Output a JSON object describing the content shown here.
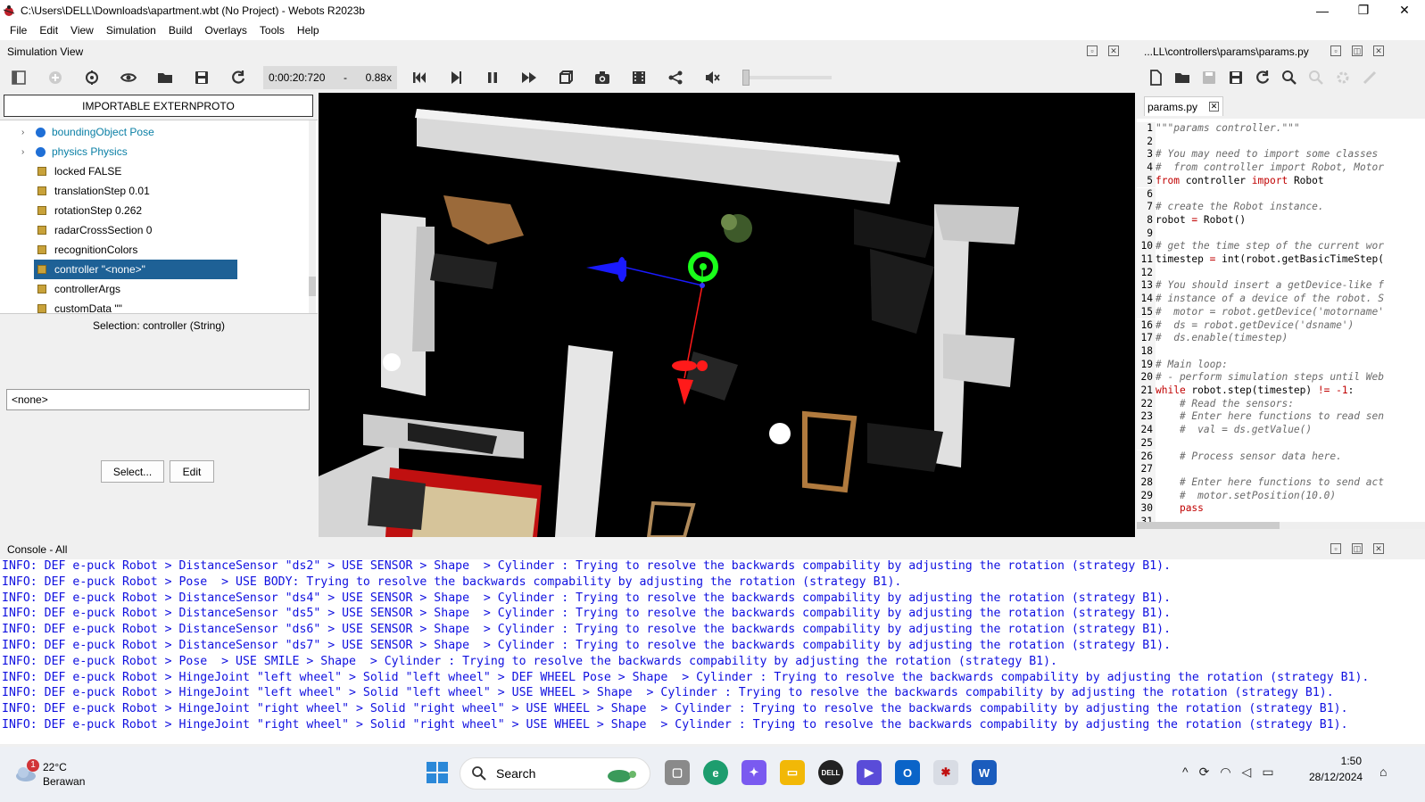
{
  "window": {
    "title": "C:\\Users\\DELL\\Downloads\\apartment.wbt (No Project) - Webots R2023b",
    "minimize": "—",
    "maximize": "❐",
    "close": "✕"
  },
  "menu": [
    "File",
    "Edit",
    "View",
    "Simulation",
    "Build",
    "Overlays",
    "Tools",
    "Help"
  ],
  "sim_view": {
    "header": "Simulation View",
    "time": "0:00:20:720",
    "dash": "-",
    "speed": "0.88x"
  },
  "scene_tree": {
    "proto_button": "IMPORTABLE EXTERNPROTO",
    "nodes": [
      {
        "label": "boundingObject Pose",
        "kind": "node"
      },
      {
        "label": "physics Physics",
        "kind": "node"
      },
      {
        "label": "locked FALSE",
        "kind": "field"
      },
      {
        "label": "translationStep 0.01",
        "kind": "field"
      },
      {
        "label": "rotationStep 0.262",
        "kind": "field"
      },
      {
        "label": "radarCrossSection 0",
        "kind": "field"
      },
      {
        "label": "recognitionColors",
        "kind": "field"
      },
      {
        "label": "controller \"<none>\"",
        "kind": "field",
        "selected": true
      },
      {
        "label": "controllerArgs",
        "kind": "field"
      },
      {
        "label": "customData \"\"",
        "kind": "field"
      }
    ],
    "selection": "Selection: controller (String)",
    "value": "<none>",
    "select_button": "Select...",
    "edit_button": "Edit"
  },
  "editor": {
    "header": "...LL\\controllers\\params\\params.py",
    "tab": "params.py",
    "lines": [
      {
        "n": "1",
        "segs": [
          [
            "cmt",
            "\"\"\"params controller.\"\"\""
          ]
        ]
      },
      {
        "n": "2",
        "segs": []
      },
      {
        "n": "3",
        "segs": [
          [
            "cmt",
            "# You may need to import some classes"
          ]
        ]
      },
      {
        "n": "4",
        "segs": [
          [
            "cmt",
            "#  from controller import Robot, Motor"
          ]
        ]
      },
      {
        "n": "5",
        "segs": [
          [
            "kw",
            "from"
          ],
          [
            "tx",
            " controller "
          ],
          [
            "kw",
            "import"
          ],
          [
            "tx",
            " Robot"
          ]
        ]
      },
      {
        "n": "6",
        "segs": []
      },
      {
        "n": "7",
        "segs": [
          [
            "cmt",
            "# create the Robot instance."
          ]
        ]
      },
      {
        "n": "8",
        "segs": [
          [
            "tx",
            "robot "
          ],
          [
            "op",
            "="
          ],
          [
            "tx",
            " Robot()"
          ]
        ]
      },
      {
        "n": "9",
        "segs": []
      },
      {
        "n": "10",
        "segs": [
          [
            "cmt",
            "# get the time step of the current wor"
          ]
        ]
      },
      {
        "n": "11",
        "segs": [
          [
            "tx",
            "timestep "
          ],
          [
            "op",
            "="
          ],
          [
            "tx",
            " int(robot.getBasicTimeStep("
          ]
        ]
      },
      {
        "n": "12",
        "segs": []
      },
      {
        "n": "13",
        "segs": [
          [
            "cmt",
            "# You should insert a getDevice-like f"
          ]
        ]
      },
      {
        "n": "14",
        "segs": [
          [
            "cmt",
            "# instance of a device of the robot. S"
          ]
        ]
      },
      {
        "n": "15",
        "segs": [
          [
            "cmt",
            "#  motor = robot.getDevice('motorname'"
          ]
        ]
      },
      {
        "n": "16",
        "segs": [
          [
            "cmt",
            "#  ds = robot.getDevice('dsname')"
          ]
        ]
      },
      {
        "n": "17",
        "segs": [
          [
            "cmt",
            "#  ds.enable(timestep)"
          ]
        ]
      },
      {
        "n": "18",
        "segs": []
      },
      {
        "n": "19",
        "segs": [
          [
            "cmt",
            "# Main loop:"
          ]
        ]
      },
      {
        "n": "20",
        "segs": [
          [
            "cmt",
            "# - perform simulation steps until Web"
          ]
        ]
      },
      {
        "n": "21",
        "segs": [
          [
            "kw",
            "while"
          ],
          [
            "tx",
            " robot.step(timestep) "
          ],
          [
            "op",
            "!="
          ],
          [
            "tx",
            " "
          ],
          [
            "op",
            "-1"
          ],
          [
            "tx",
            ":"
          ]
        ]
      },
      {
        "n": "22",
        "segs": [
          [
            "tx",
            "    "
          ],
          [
            "cmt",
            "# Read the sensors:"
          ]
        ]
      },
      {
        "n": "23",
        "segs": [
          [
            "tx",
            "    "
          ],
          [
            "cmt",
            "# Enter here functions to read sen"
          ]
        ]
      },
      {
        "n": "24",
        "segs": [
          [
            "tx",
            "    "
          ],
          [
            "cmt",
            "#  val = ds.getValue()"
          ]
        ]
      },
      {
        "n": "25",
        "segs": []
      },
      {
        "n": "26",
        "segs": [
          [
            "tx",
            "    "
          ],
          [
            "cmt",
            "# Process sensor data here."
          ]
        ]
      },
      {
        "n": "27",
        "segs": []
      },
      {
        "n": "28",
        "segs": [
          [
            "tx",
            "    "
          ],
          [
            "cmt",
            "# Enter here functions to send act"
          ]
        ]
      },
      {
        "n": "29",
        "segs": [
          [
            "tx",
            "    "
          ],
          [
            "cmt",
            "#  motor.setPosition(10.0)"
          ]
        ]
      },
      {
        "n": "30",
        "segs": [
          [
            "tx",
            "    "
          ],
          [
            "kw",
            "pass"
          ]
        ]
      },
      {
        "n": "31",
        "segs": []
      }
    ]
  },
  "console": {
    "header": "Console - All",
    "lines": [
      "INFO: DEF e-puck Robot > DistanceSensor \"ds2\" > USE SENSOR > Shape  > Cylinder : Trying to resolve the backwards compability by adjusting the rotation (strategy B1).",
      "INFO: DEF e-puck Robot > Pose  > USE BODY: Trying to resolve the backwards compability by adjusting the rotation (strategy B1).",
      "INFO: DEF e-puck Robot > DistanceSensor \"ds4\" > USE SENSOR > Shape  > Cylinder : Trying to resolve the backwards compability by adjusting the rotation (strategy B1).",
      "INFO: DEF e-puck Robot > DistanceSensor \"ds5\" > USE SENSOR > Shape  > Cylinder : Trying to resolve the backwards compability by adjusting the rotation (strategy B1).",
      "INFO: DEF e-puck Robot > DistanceSensor \"ds6\" > USE SENSOR > Shape  > Cylinder : Trying to resolve the backwards compability by adjusting the rotation (strategy B1).",
      "INFO: DEF e-puck Robot > DistanceSensor \"ds7\" > USE SENSOR > Shape  > Cylinder : Trying to resolve the backwards compability by adjusting the rotation (strategy B1).",
      "INFO: DEF e-puck Robot > Pose  > USE SMILE > Shape  > Cylinder : Trying to resolve the backwards compability by adjusting the rotation (strategy B1).",
      "INFO: DEF e-puck Robot > HingeJoint \"left wheel\" > Solid \"left wheel\" > DEF WHEEL Pose > Shape  > Cylinder : Trying to resolve the backwards compability by adjusting the rotation (strategy B1).",
      "INFO: DEF e-puck Robot > HingeJoint \"left wheel\" > Solid \"left wheel\" > USE WHEEL > Shape  > Cylinder : Trying to resolve the backwards compability by adjusting the rotation (strategy B1).",
      "INFO: DEF e-puck Robot > HingeJoint \"right wheel\" > Solid \"right wheel\" > USE WHEEL > Shape  > Cylinder : Trying to resolve the backwards compability by adjusting the rotation (strategy B1).",
      "INFO: DEF e-puck Robot > HingeJoint \"right wheel\" > Solid \"right wheel\" > USE WHEEL > Shape  > Cylinder : Trying to resolve the backwards compability by adjusting the rotation (strategy B1)."
    ]
  },
  "taskbar": {
    "weather_badge": "1",
    "temperature": "22°C",
    "weather": "Berawan",
    "search": "Search",
    "time": "1:50",
    "date": "28/12/2024"
  },
  "colors": {
    "selection": "#1e6196",
    "console_text": "#1010e0",
    "keyword": "#c00000"
  }
}
